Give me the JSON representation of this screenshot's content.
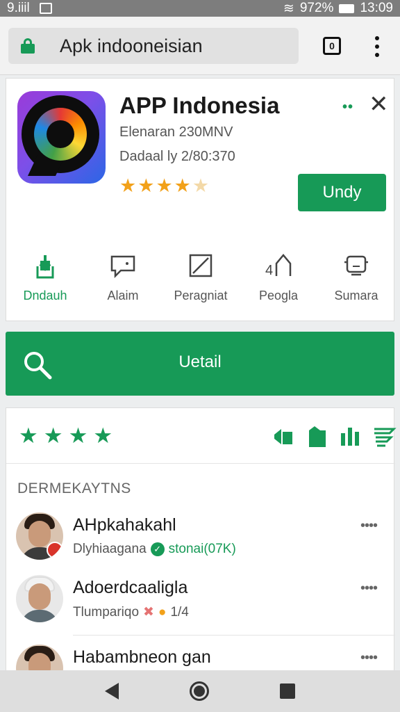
{
  "status_bar": {
    "left_text": "9.iiil",
    "battery": "972%",
    "time": "13:09"
  },
  "browser": {
    "url": "Apk indooneisian",
    "tab_count": "0"
  },
  "app": {
    "title": "APP Indonesia",
    "subtitle1": "Elenaran 230MNV",
    "subtitle2": "Dadaal ly 2/80:370",
    "rating_stars": 4.5,
    "install_label": "Undy",
    "accent_color": "#179a57",
    "actions": [
      {
        "label": "Dndauh",
        "icon": "download-icon"
      },
      {
        "label": "Alaim",
        "icon": "chat-icon"
      },
      {
        "label": "Peragniat",
        "icon": "edit-icon"
      },
      {
        "label": "Peogla",
        "icon": "people-icon"
      },
      {
        "label": "Sumara",
        "icon": "face-icon"
      }
    ]
  },
  "search_banner": {
    "label": "Uetail"
  },
  "reviews": {
    "rating_stars": 4,
    "section_label": "DERMEKAYTNS",
    "items": [
      {
        "name": "AHpkahakahl",
        "meta": "Dlyhiaagana",
        "meta_extra": "stonai(07K)"
      },
      {
        "name": "Adoerdcaaligla",
        "meta": "Tlumpariqo",
        "meta_extra": "1/4"
      },
      {
        "name": "Habambneon gan",
        "meta": "",
        "meta_extra": ""
      }
    ]
  }
}
